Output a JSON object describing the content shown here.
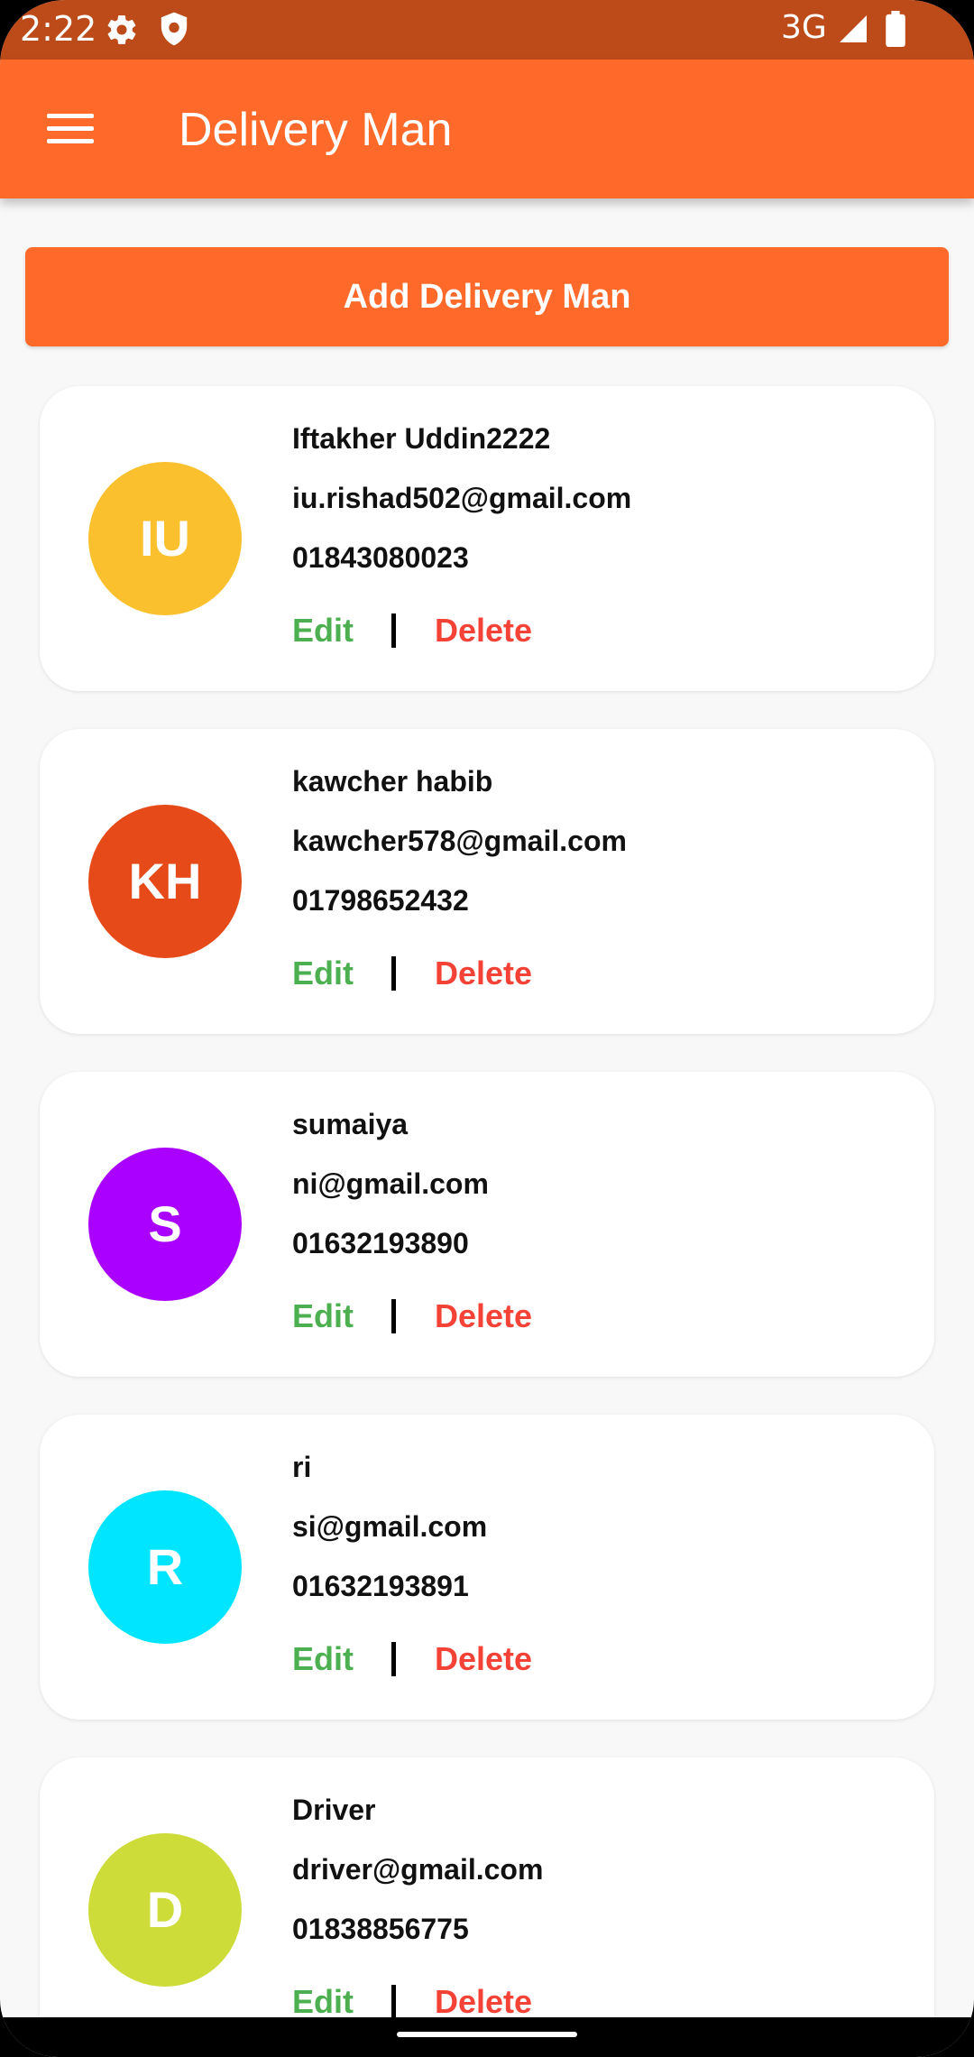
{
  "status_bar": {
    "time": "2:22",
    "network": "3G",
    "icons": [
      "gear-icon",
      "shield-icon",
      "signal-icon",
      "battery-icon"
    ]
  },
  "app_bar": {
    "title": "Delivery Man",
    "menu_icon": "menu-icon"
  },
  "add_button_label": "Add Delivery Man",
  "colors": {
    "status_bar": "#bd4b1a",
    "app_bar": "#ff6a2a",
    "edit": "#4caf50",
    "delete": "#f44336"
  },
  "delivery_men": [
    {
      "initials": "IU",
      "avatar_color": "#fbc02d",
      "name": "Iftakher Uddin2222",
      "email": "iu.rishad502@gmail.com",
      "phone": "01843080023",
      "edit_label": "Edit",
      "delete_label": "Delete"
    },
    {
      "initials": "KH",
      "avatar_color": "#e64a19",
      "name": "kawcher habib",
      "email": "kawcher578@gmail.com",
      "phone": "01798652432",
      "edit_label": "Edit",
      "delete_label": "Delete"
    },
    {
      "initials": "S",
      "avatar_color": "#aa00ff",
      "name": "sumaiya",
      "email": "ni@gmail.com",
      "phone": "01632193890",
      "edit_label": "Edit",
      "delete_label": "Delete"
    },
    {
      "initials": "R",
      "avatar_color": "#00e5ff",
      "name": "ri",
      "email": "si@gmail.com",
      "phone": "01632193891",
      "edit_label": "Edit",
      "delete_label": "Delete"
    },
    {
      "initials": "D",
      "avatar_color": "#cddc39",
      "name": "Driver",
      "email": "driver@gmail.com",
      "phone": "01838856775",
      "edit_label": "Edit",
      "delete_label": "Delete"
    }
  ]
}
